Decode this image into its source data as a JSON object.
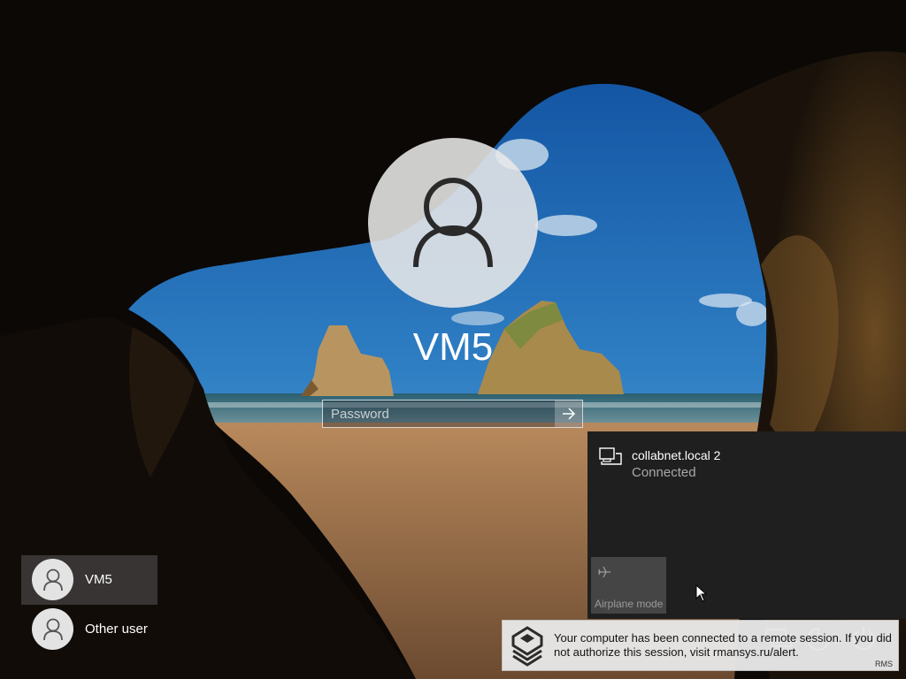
{
  "lock_screen": {
    "username": "VM5",
    "password_placeholder": "Password"
  },
  "user_list": [
    {
      "label": "VM5",
      "selected": true
    },
    {
      "label": "Other user",
      "selected": false
    }
  ],
  "network_panel": {
    "network_name": "collabnet.local 2",
    "network_status": "Connected",
    "airplane_mode_label": "Airplane mode"
  },
  "notification": {
    "message": "Your computer has been connected to a remote session. If you did not authorize this session, visit rmansys.ru/alert.",
    "brand": "RMS"
  },
  "system_icons": [
    "network-icon",
    "accessibility-icon",
    "power-icon"
  ]
}
